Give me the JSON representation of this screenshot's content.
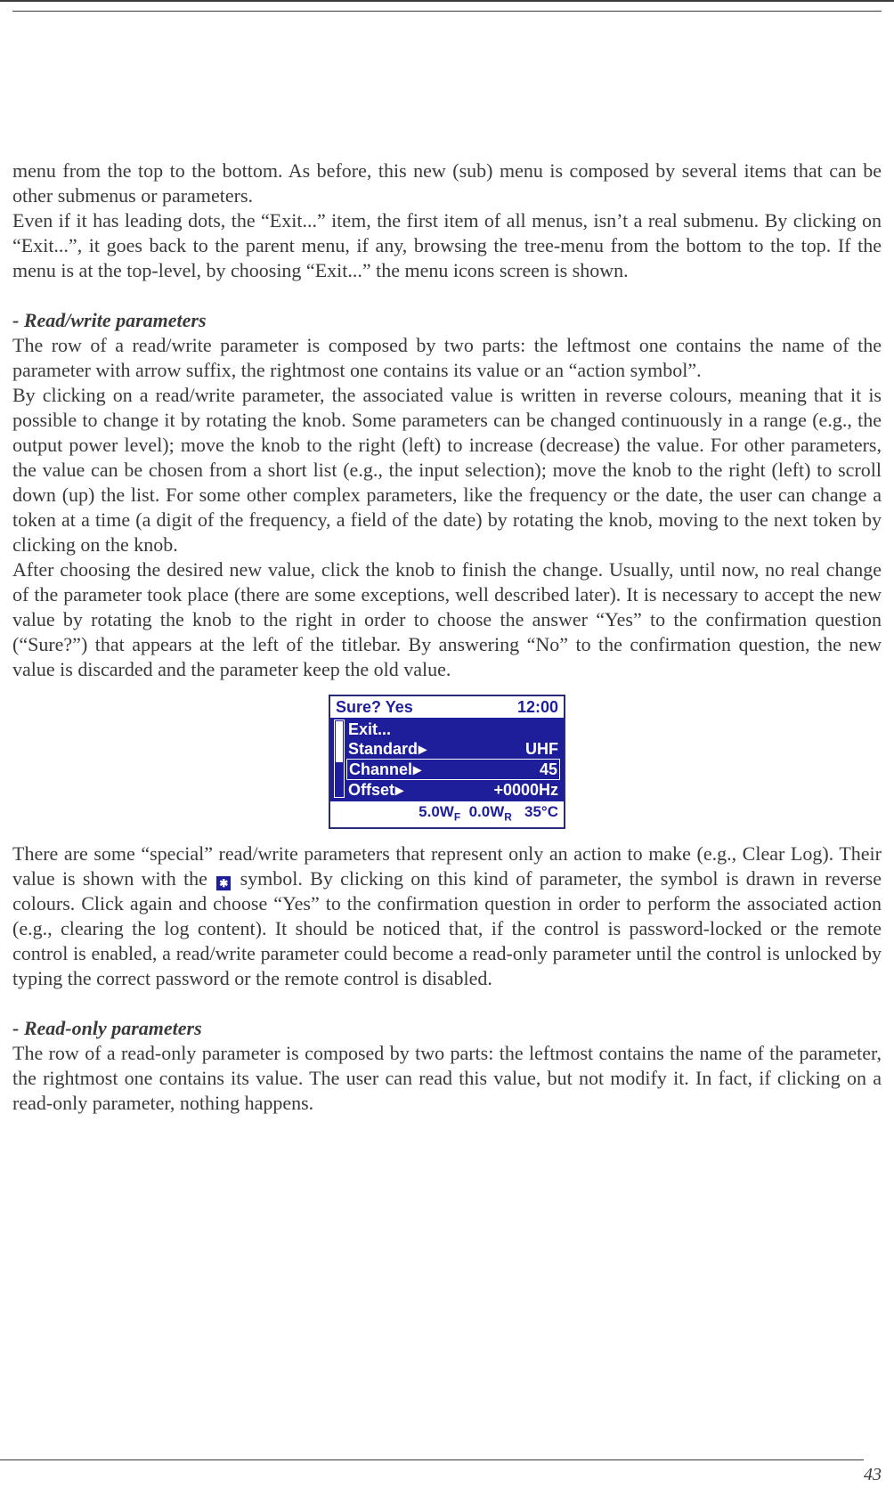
{
  "paras": {
    "p1": "menu from the top to the bottom. As before, this new (sub) menu is composed by several items that can be other submenus or parameters.",
    "p2": "Even if it has leading dots, the “Exit...” item, the first item of all menus, isn’t a real submenu. By clicking on “Exit...”, it goes back to the parent menu, if any, browsing the tree-menu from the bottom to the top. If the menu is at the top-level, by choosing “Exit...” the menu icons screen is shown.",
    "h1": "- Read/write parameters",
    "p3": "The row of a read/write parameter is composed by two parts: the leftmost one contains the name of the parameter with arrow suffix, the rightmost one contains its value or an “action symbol”.",
    "p4": "By clicking on a read/write parameter, the associated value is written in reverse colours, meaning that it is possible to change it by rotating the knob. Some parameters can be changed continuously in a range (e.g., the output power level); move the knob to the right (left) to increase (decrease) the value. For other parameters, the value can be chosen from a short list (e.g., the input selection); move the knob to the right (left) to scroll down (up) the list. For some other complex parameters, like the frequency or the date, the user can change a token at a time (a digit of the frequency, a field of the date) by rotating the knob, moving to the next token by clicking on the knob.",
    "p5": "After choosing the desired new value, click the knob to finish the change. Usually, until now, no real change of the parameter took place (there are some exceptions, well described later). It is necessary to accept the new value by rotating the knob to the right in order to choose the answer “Yes” to the confirmation question (“Sure?”) that appears at the left of the titlebar. By answering “No” to the confirmation question, the new value is discarded and the parameter keep the old value.",
    "p6a": "There are some “special” read/write parameters that represent only an action to make (e.g., Clear Log). Their value is shown with the ",
    "p6_sym": "✱",
    "p6b": " symbol. By clicking on this kind of parameter, the  symbol is drawn in reverse colours. Click again and choose “Yes” to the confirmation question in order to perform the associated action (e.g., clearing the log content). It should be noticed that, if the control is password-locked or the remote control is enabled, a read/write parameter could become a read-only parameter until the control is unlocked by typing the correct password or the remote control is disabled.",
    "h2": "- Read-only parameters",
    "p7": "The row of a read-only parameter is composed by two parts: the leftmost contains the name of the parameter, the rightmost one contains its value. The user can read this value, but not modify it. In fact, if clicking on a read-only parameter, nothing happens."
  },
  "lcd": {
    "title_left": "Sure?  Yes",
    "title_right": "12:00",
    "rows": [
      {
        "label": "Exit...",
        "value": "",
        "selected": false,
        "arrow": false
      },
      {
        "label": "Standard",
        "value": "UHF",
        "selected": false,
        "arrow": true
      },
      {
        "label": "Channel",
        "value": "45",
        "selected": true,
        "arrow": true
      },
      {
        "label": "Offset",
        "value": "+0000Hz",
        "selected": false,
        "arrow": true
      }
    ],
    "footer_wf": "5.0W",
    "footer_wf_sub": "F",
    "footer_wr": "0.0W",
    "footer_wr_sub": "R",
    "footer_temp": "35°C"
  },
  "page_number": "43"
}
